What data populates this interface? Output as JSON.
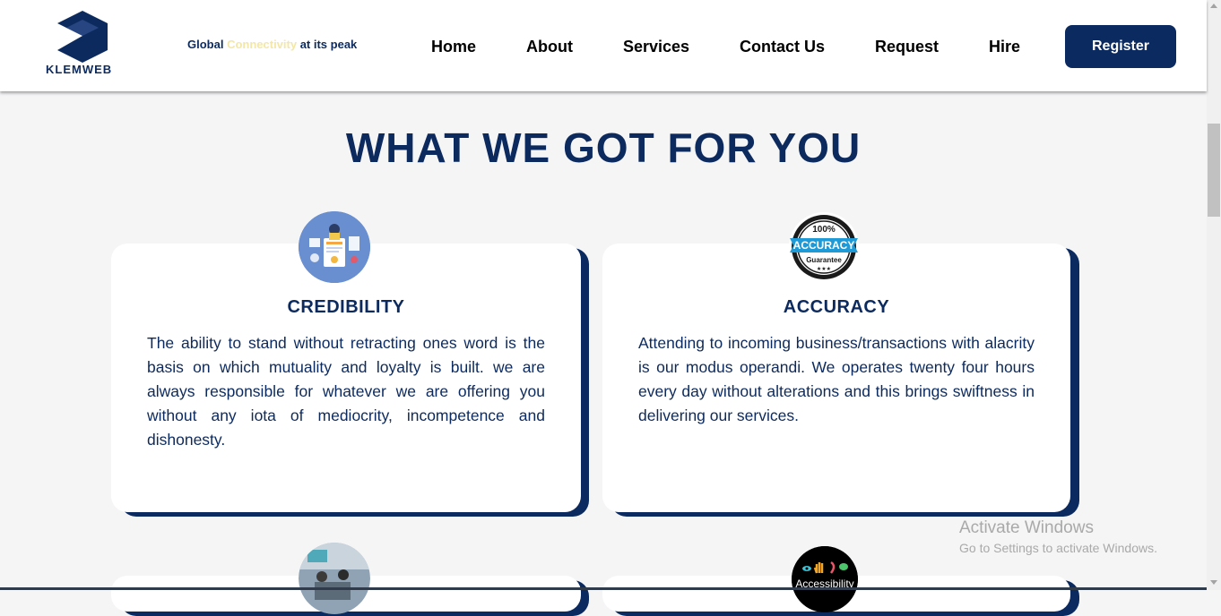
{
  "header": {
    "logo_text": "KLEMWEB",
    "tagline": {
      "before": "Global ",
      "highlight": "Connectivity",
      "after": " at its peak"
    },
    "nav": [
      "Home",
      "About",
      "Services",
      "Contact Us",
      "Request",
      "Hire"
    ],
    "register_label": "Register"
  },
  "section": {
    "title": "WHAT WE GOT FOR YOU"
  },
  "cards": [
    {
      "title": "CREDIBILITY",
      "text": "The ability to stand without retracting ones word is the basis on which mutuality and loyalty is built. we are always responsible for whatever we are offering you without any iota of mediocrity, incompetence and dishonesty."
    },
    {
      "title": "ACCURACY",
      "text": "Attending to incoming business/transactions with alacrity is our modus operandi. We operates twenty four hours every day without alterations and this brings swiftness in delivering our services.",
      "badge": {
        "top": "100%",
        "main": "ACCURACY",
        "bottom": "Guarantee"
      }
    }
  ],
  "lower_cards": [
    {
      "icon_label": ""
    },
    {
      "icon_label": "Accessibility"
    }
  ],
  "watermark": {
    "line1": "Activate Windows",
    "line2": "Go to Settings to activate Windows."
  },
  "colors": {
    "navy": "#0c2a5e",
    "button": "#0b2a60",
    "highlight": "#f3e7a7",
    "page_bg": "#f5f5f6"
  }
}
